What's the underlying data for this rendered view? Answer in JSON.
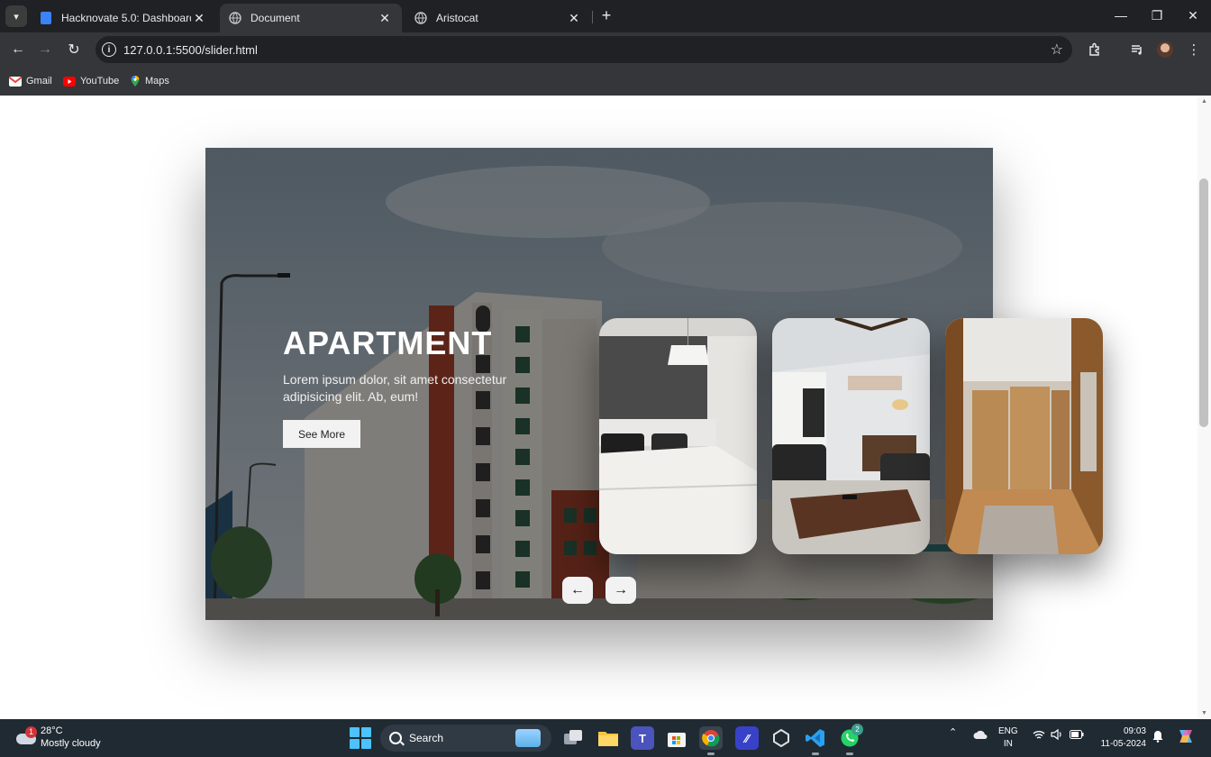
{
  "browser": {
    "tabs": [
      {
        "title": "Hacknovate 5.0: Dashboard | De",
        "icon": "doc-icon",
        "active": false
      },
      {
        "title": "Document",
        "icon": "globe-icon",
        "active": true
      },
      {
        "title": "Aristocat",
        "icon": "globe-icon",
        "active": false
      }
    ],
    "url": "127.0.0.1:5500/slider.html",
    "bookmarks": [
      {
        "label": "Gmail",
        "icon": "gmail-icon"
      },
      {
        "label": "YouTube",
        "icon": "youtube-icon"
      },
      {
        "label": "Maps",
        "icon": "maps-icon"
      }
    ]
  },
  "slider": {
    "title": "APARTMENT",
    "description": "Lorem ipsum dolor, sit amet consectetur adipisicing elit. Ab, eum!",
    "button_label": "See More",
    "prev_icon": "arrow-left-icon",
    "next_icon": "arrow-right-icon",
    "thumbnails": [
      "bedroom",
      "living-room",
      "hallway"
    ]
  },
  "taskbar": {
    "weather_temp": "28°C",
    "weather_desc": "Mostly cloudy",
    "weather_badge": "1",
    "search_label": "Search",
    "whatsapp_badge": "2",
    "lang_line1": "ENG",
    "lang_line2": "IN",
    "time": "09:03",
    "date": "11-05-2024"
  },
  "colors": {
    "chrome_dark": "#202124",
    "chrome_toolbar": "#35363a",
    "taskbar": "#202a33",
    "accent": "#4cc2ff"
  }
}
